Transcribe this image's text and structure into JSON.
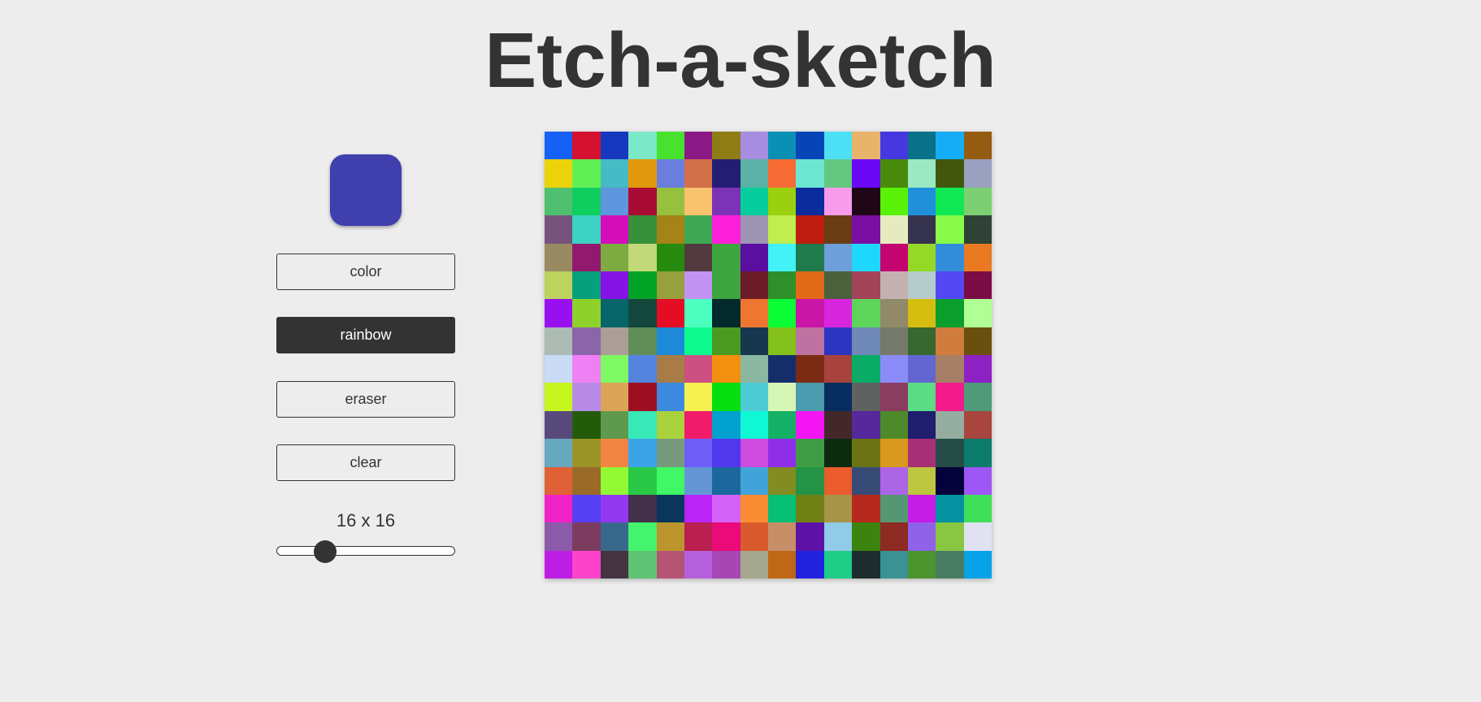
{
  "title": "Etch-a-sketch",
  "color_picker": {
    "value": "#3f3fae"
  },
  "buttons": [
    {
      "label": "color",
      "active": false
    },
    {
      "label": "rainbow",
      "active": true
    },
    {
      "label": "eraser",
      "active": false
    },
    {
      "label": "clear",
      "active": false
    }
  ],
  "grid_size": {
    "label": "16 x 16",
    "value": 16,
    "min": 1,
    "max": 64
  },
  "grid_colors": [
    [
      "#1560f5",
      "#d41131",
      "#1538bf",
      "#7be8c7",
      "#46e22e",
      "#8b1985",
      "#8d7d14",
      "#a68de0",
      "#0a8fb5",
      "#0644b8",
      "#4de0f5",
      "#e8b36b",
      "#4638e0",
      "#0a718a",
      "#14adf5",
      "#955c11"
    ],
    [
      "#ebd30a",
      "#60f055",
      "#46bac5",
      "#e2980c",
      "#6a7ede",
      "#d2704a",
      "#241d73",
      "#5bb1a5",
      "#f76c34",
      "#6ce7d2",
      "#64c87f",
      "#6a0af5",
      "#488b0c",
      "#9ae9c2",
      "#43560d",
      "#9aa0c0"
    ],
    [
      "#4fc070",
      "#0fce5f",
      "#5e96e0",
      "#a80b33",
      "#97c03f",
      "#f9c26c",
      "#7d33b6",
      "#05ce9c",
      "#9ad00d",
      "#0c2b9d",
      "#f89bea",
      "#1f0718",
      "#5bf20a",
      "#2190da",
      "#10e954",
      "#7dd071"
    ],
    [
      "#76527d",
      "#3dd2c2",
      "#d50db9",
      "#37913a",
      "#a58316",
      "#3fa854",
      "#fb20d8",
      "#9d95b3",
      "#bfee4e",
      "#be1d10",
      "#6a3c14",
      "#7b0fa3",
      "#e6ebbf",
      "#36334e",
      "#8afa48",
      "#2e4336"
    ],
    [
      "#9a8a62",
      "#921a6e",
      "#7dab41",
      "#c2d979",
      "#268a0e",
      "#523a3e",
      "#3fa53f",
      "#5a0fa0",
      "#42f2f6",
      "#217a4c",
      "#6f9fd8",
      "#1ed7fa",
      "#c3066f",
      "#95d928",
      "#318dd9",
      "#e97a22"
    ],
    [
      "#bcd45e",
      "#08a07b",
      "#8613e5",
      "#01a326",
      "#97a03d",
      "#c293f3",
      "#3fa53f",
      "#6b1c28",
      "#2f8f2b",
      "#e06a18",
      "#4a613c",
      "#a3435a",
      "#c4b2b3",
      "#b6cccc",
      "#5348f3",
      "#7a0c45"
    ],
    [
      "#9910f0",
      "#8fd12b",
      "#076569",
      "#14473c",
      "#e40d24",
      "#4cffbf",
      "#03292d",
      "#ef7630",
      "#0afd35",
      "#c916a7",
      "#d826de",
      "#5dd55a",
      "#908a68",
      "#d6be11",
      "#0b9e2d",
      "#b0ff94"
    ],
    [
      "#adbbb5",
      "#8a65aa",
      "#ab9e96",
      "#608d58",
      "#1d8ad9",
      "#0dfb8e",
      "#4c9922",
      "#17374f",
      "#84c11a",
      "#bd72a1",
      "#2c35bf",
      "#6e88b7",
      "#757a6a",
      "#38672f",
      "#d17c3f",
      "#6a500f"
    ],
    [
      "#c9dbf6",
      "#ee80f4",
      "#7ef863",
      "#5384df",
      "#a77c46",
      "#cd5083",
      "#f4900f",
      "#8bb8a1",
      "#142e6c",
      "#7b2b13",
      "#a7433c",
      "#09ab66",
      "#8b8cf8",
      "#6366d0",
      "#a77f66",
      "#8e21c4"
    ],
    [
      "#c6f41d",
      "#b78be5",
      "#dca459",
      "#9c0f22",
      "#3e89e0",
      "#f6f14f",
      "#06de10",
      "#4ccbd5",
      "#d6f6b5",
      "#4c9bae",
      "#072d5e",
      "#5f6260",
      "#8b3c61",
      "#5cdc85",
      "#f31a8c",
      "#4f9a78"
    ],
    [
      "#574a7b",
      "#235b0b",
      "#5e994d",
      "#38e8b6",
      "#a9d23c",
      "#f01c6b",
      "#01a0ce",
      "#10f7d5",
      "#15b065",
      "#f316f3",
      "#43282a",
      "#55289b",
      "#4d8a2a",
      "#201e6c",
      "#95aca0",
      "#a8453f"
    ],
    [
      "#67a8c1",
      "#9b9427",
      "#f18541",
      "#3aa4e6",
      "#779a7e",
      "#6e5ef7",
      "#5138ec",
      "#cf4ade",
      "#902de9",
      "#3f9c45",
      "#0c2b0e",
      "#6b7314",
      "#d8991d",
      "#a72f75",
      "#264c48",
      "#0d7b6b"
    ],
    [
      "#df6135",
      "#9a6a29",
      "#92fa35",
      "#29c847",
      "#40f766",
      "#6496d6",
      "#1c689c",
      "#41a4d8",
      "#828c21",
      "#249346",
      "#ea5b2e",
      "#374b76",
      "#ac65e6",
      "#bcc63e",
      "#05013b",
      "#9e56f7"
    ],
    [
      "#f121c8",
      "#573ff2",
      "#9238ee",
      "#423149",
      "#0b365b",
      "#ba24f4",
      "#d363f6",
      "#f98c33",
      "#07bf76",
      "#6f8213",
      "#a79449",
      "#b52a1c",
      "#559673",
      "#c51ce6",
      "#0592a1",
      "#3fdf5a"
    ],
    [
      "#8b5baa",
      "#7c3c5f",
      "#38698c",
      "#44f46c",
      "#bc952c",
      "#ba204f",
      "#ea0a79",
      "#d95b2d",
      "#c78f67",
      "#5c12a6",
      "#90cbe7",
      "#3c840f",
      "#8d2a21",
      "#8f62e9",
      "#89c742",
      "#e0e2f1"
    ],
    [
      "#be1ee3",
      "#fc43c9",
      "#433440",
      "#60c274",
      "#b55472",
      "#b561dd",
      "#a747b4",
      "#a4a88f",
      "#c06716",
      "#2221de",
      "#1ecc87",
      "#1d2c2c",
      "#3b9294",
      "#4c942e",
      "#4a7b63",
      "#06a3e8"
    ]
  ]
}
